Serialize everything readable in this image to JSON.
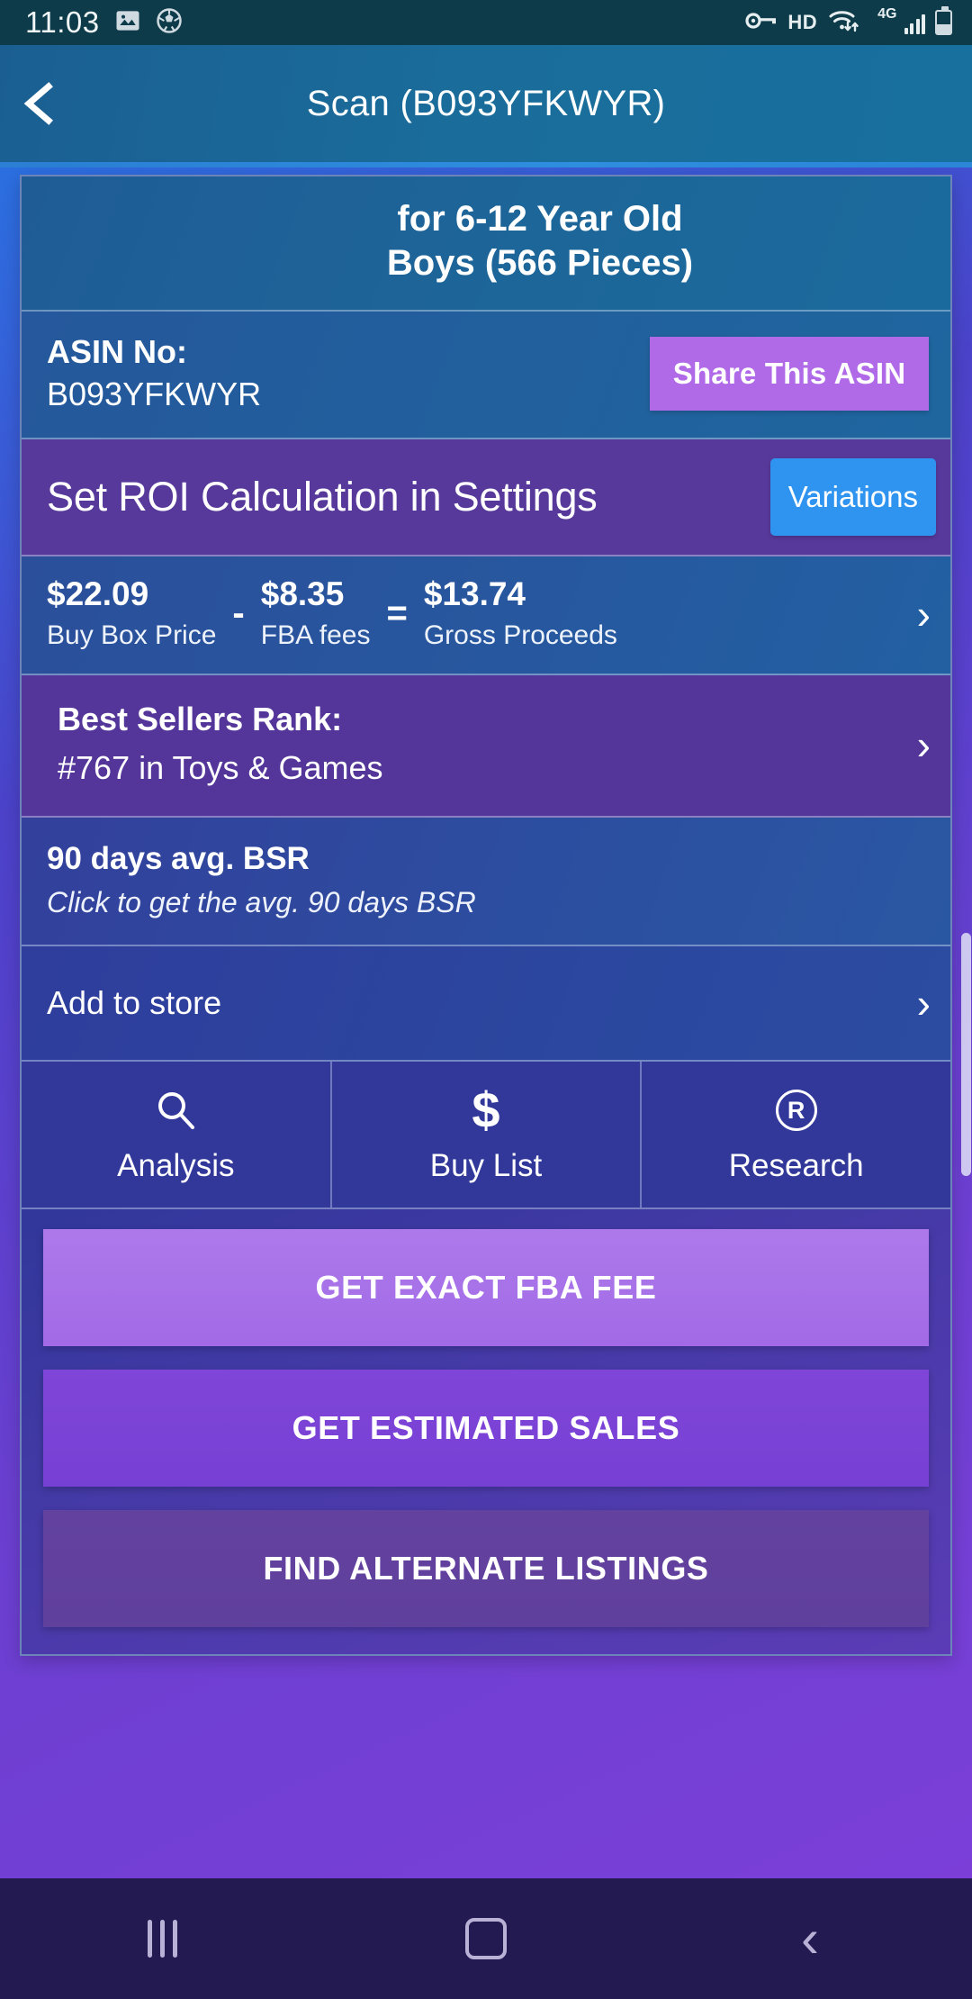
{
  "status_bar": {
    "clock": "11:03",
    "hd_label": "HD",
    "network_label": "4G",
    "icons": [
      "image-icon",
      "soccer-ball-icon",
      "vpn-key-icon",
      "hd-icon",
      "wifi-icon",
      "signal-bars-icon",
      "battery-icon"
    ]
  },
  "app_bar": {
    "back_icon": "back-arrow-icon",
    "title": "Scan (B093YFKWYR)"
  },
  "product": {
    "title_line1": "for 6-12 Year Old",
    "title_line2": "Boys (566 Pieces)"
  },
  "asin": {
    "label": "ASIN No:",
    "value": "B093YFKWYR",
    "share_button": "Share This ASIN"
  },
  "roi": {
    "text": "Set ROI Calculation in Settings",
    "variations_button": "Variations"
  },
  "price": {
    "buy_box": {
      "value": "$22.09",
      "label": "Buy Box Price"
    },
    "minus": "-",
    "fba": {
      "value": "$8.35",
      "label": "FBA fees"
    },
    "equals": "=",
    "gross": {
      "value": "$13.74",
      "label": "Gross Proceeds"
    },
    "chevron": "›"
  },
  "bsr": {
    "label": "Best Sellers Rank:",
    "value": "#767 in Toys & Games",
    "chevron": "›"
  },
  "avg_bsr": {
    "label": "90 days avg. BSR",
    "hint": "Click to get the avg. 90 days BSR"
  },
  "add_store": {
    "label": "Add to store",
    "chevron": "›"
  },
  "tabs": [
    {
      "label": "Analysis",
      "icon": "search-icon"
    },
    {
      "label": "Buy List",
      "icon": "dollar-icon"
    },
    {
      "label": "Research",
      "icon": "registered-r-icon"
    }
  ],
  "actions": [
    {
      "label": "GET EXACT FBA FEE"
    },
    {
      "label": "GET ESTIMATED SALES"
    },
    {
      "label": "FIND ALTERNATE LISTINGS"
    }
  ],
  "nav_bar": {
    "recents": "recents-icon",
    "home": "home-icon",
    "back": "back-icon"
  },
  "colors": {
    "status_bar": "#0d3b4a",
    "app_bar": "#1a6d9b",
    "accent_line": "#2f8fe0",
    "share_button": "#b06ae8",
    "variations_button": "#2f93f0",
    "purple_row": "#57399b",
    "blue_row": "#2b4f9b",
    "action_1": "#ad79ea",
    "action_2": "#7f45d8",
    "action_3": "#63429f",
    "nav_bar": "#241a52"
  }
}
